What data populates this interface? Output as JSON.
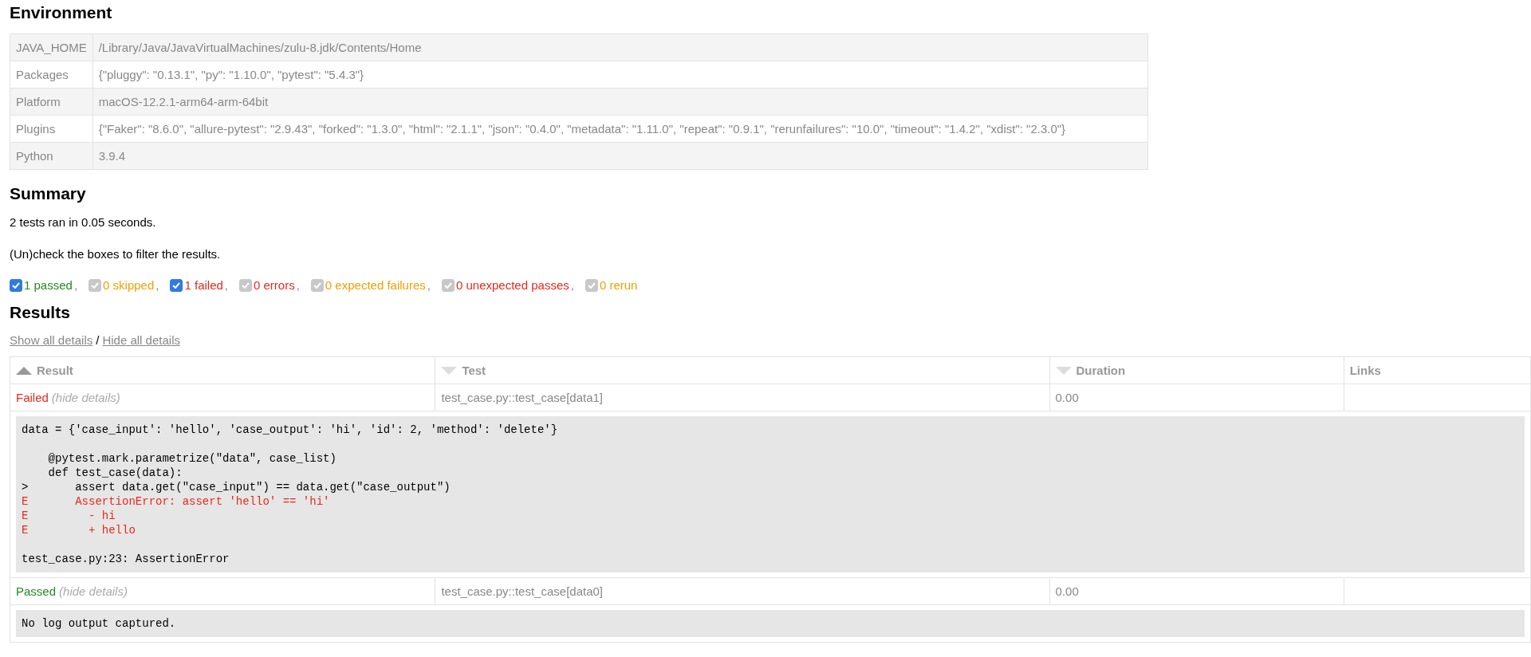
{
  "environment": {
    "title": "Environment",
    "rows": [
      {
        "key": "JAVA_HOME",
        "value": "/Library/Java/JavaVirtualMachines/zulu-8.jdk/Contents/Home"
      },
      {
        "key": "Packages",
        "value": "{\"pluggy\": \"0.13.1\", \"py\": \"1.10.0\", \"pytest\": \"5.4.3\"}"
      },
      {
        "key": "Platform",
        "value": "macOS-12.2.1-arm64-arm-64bit"
      },
      {
        "key": "Plugins",
        "value": "{\"Faker\": \"8.6.0\", \"allure-pytest\": \"2.9.43\", \"forked\": \"1.3.0\", \"html\": \"2.1.1\", \"json\": \"0.4.0\", \"metadata\": \"1.11.0\", \"repeat\": \"0.9.1\", \"rerunfailures\": \"10.0\", \"timeout\": \"1.4.2\", \"xdist\": \"2.3.0\"}"
      },
      {
        "key": "Python",
        "value": "3.9.4"
      }
    ]
  },
  "summary": {
    "title": "Summary",
    "run_text": "2 tests ran in 0.05 seconds.",
    "hint": "(Un)check the boxes to filter the results.",
    "filters": [
      {
        "label": "1 passed",
        "separator": ",",
        "checked": true,
        "disabled": false,
        "color": "#228b22"
      },
      {
        "label": "0 skipped",
        "separator": ",",
        "checked": true,
        "disabled": true,
        "color": "#f0a000"
      },
      {
        "label": "1 failed",
        "separator": ",",
        "checked": true,
        "disabled": false,
        "color": "#e8291c"
      },
      {
        "label": "0 errors",
        "separator": ",",
        "checked": true,
        "disabled": true,
        "color": "#e8291c"
      },
      {
        "label": "0 expected failures",
        "separator": ",",
        "checked": true,
        "disabled": true,
        "color": "#f0a000"
      },
      {
        "label": "0 unexpected passes",
        "separator": ",",
        "checked": true,
        "disabled": true,
        "color": "#e8291c"
      },
      {
        "label": "0 rerun",
        "checked": true,
        "disabled": true,
        "color": "#f0a000"
      }
    ]
  },
  "results": {
    "title": "Results",
    "show_all": "Show all details",
    "separator": "/",
    "hide_all": "Hide all details",
    "columns": [
      {
        "label": "Result",
        "kind": "sorted"
      },
      {
        "label": "Test",
        "kind": "sortable"
      },
      {
        "label": "Duration",
        "kind": "sortable"
      },
      {
        "label": "Links",
        "kind": "plain"
      }
    ],
    "rows": [
      {
        "outcome": "Failed",
        "kind": "failed",
        "toggle": "(hide details)",
        "test": "test_case.py::test_case[data1]",
        "duration": "0.00",
        "log": [
          {
            "kind": "code",
            "text": "data = {'case_input': 'hello', 'case_output': 'hi', 'id': 2, 'method': 'delete'}"
          },
          {
            "kind": "blank"
          },
          {
            "kind": "code",
            "text": "    @pytest.mark.parametrize(\"data\", case_list)"
          },
          {
            "kind": "code",
            "text": "    def test_case(data):"
          },
          {
            "kind": "code",
            "text": ">       assert data.get(\"case_input\") == data.get(\"case_output\")"
          },
          {
            "kind": "error",
            "text": "E       AssertionError: assert 'hello' == 'hi'"
          },
          {
            "kind": "error",
            "text": "E         - hi"
          },
          {
            "kind": "error",
            "text": "E         + hello"
          },
          {
            "kind": "blank"
          },
          {
            "kind": "code",
            "text": "test_case.py:23: AssertionError"
          }
        ]
      },
      {
        "outcome": "Passed",
        "kind": "passed",
        "toggle": "(hide details)",
        "test": "test_case.py::test_case[data0]",
        "duration": "0.00",
        "log": [
          {
            "kind": "code",
            "text": "No log output captured."
          }
        ]
      }
    ]
  }
}
